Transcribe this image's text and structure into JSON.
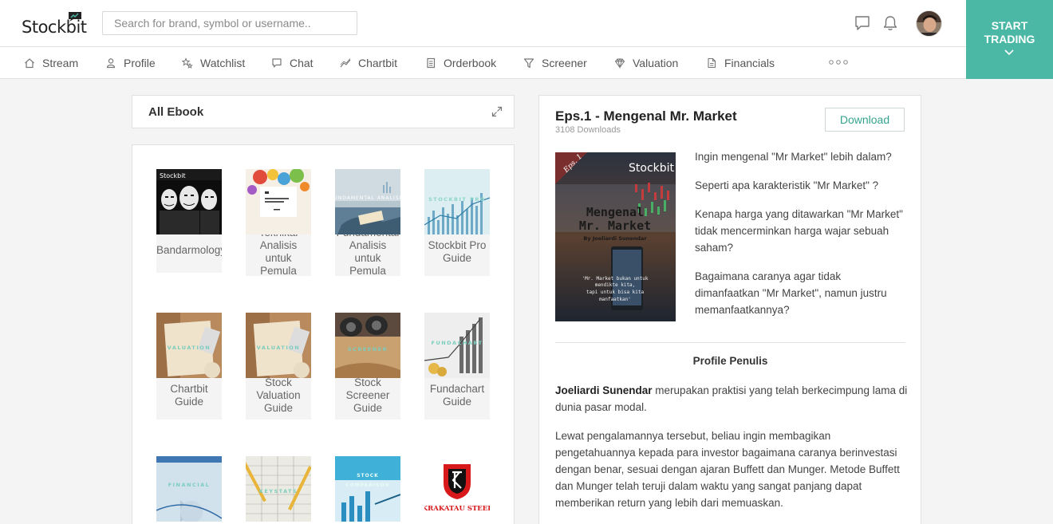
{
  "header": {
    "logo_text": "Stockbit",
    "search_placeholder": "Search for brand, symbol or username..",
    "start_trading_label": "START TRADING"
  },
  "nav": {
    "items": [
      {
        "label": "Stream",
        "icon": "home-icon"
      },
      {
        "label": "Profile",
        "icon": "user-icon"
      },
      {
        "label": "Watchlist",
        "icon": "stars-icon"
      },
      {
        "label": "Chat",
        "icon": "chat-icon"
      },
      {
        "label": "Chartbit",
        "icon": "chart-line-icon"
      },
      {
        "label": "Orderbook",
        "icon": "document-icon"
      },
      {
        "label": "Screener",
        "icon": "filter-icon"
      },
      {
        "label": "Valuation",
        "icon": "diamond-icon"
      },
      {
        "label": "Financials",
        "icon": "file-icon"
      }
    ]
  },
  "ebook_list": {
    "title": "All Ebook",
    "books": [
      {
        "title": "Bandarmology"
      },
      {
        "title": "Teknikal Analisis untuk Pemula"
      },
      {
        "title": "Fundamental Analisis untuk Pemula"
      },
      {
        "title": "Stockbit Pro Guide"
      },
      {
        "title": "Chartbit Guide"
      },
      {
        "title": "Stock Valuation Guide"
      },
      {
        "title": "Stock Screener Guide"
      },
      {
        "title": "Fundachart Guide"
      }
    ]
  },
  "detail": {
    "title": "Eps.1 - Mengenal Mr. Market",
    "downloads": "3108 Downloads",
    "download_label": "Download",
    "cover": {
      "badge": "Eps. 1",
      "brand": "Stockbit",
      "title_line1": "Mengenal",
      "title_line2": "Mr. Market",
      "author": "By Joeliardi Sunendar",
      "quote_line1": "'Mr. Market bukan untuk",
      "quote_line2": "mendikte kita,",
      "quote_line3": "tapi untuk bisa kita",
      "quote_line4": "manfaatkan'"
    },
    "questions": [
      "Ingin mengenal \"Mr Market\" lebih dalam?",
      "Seperti apa karakteristik \"Mr Market\" ?",
      "Kenapa harga yang ditawarkan \"Mr Market\" tidak mencerminkan harga wajar sebuah saham?",
      "Bagaimana caranya agar tidak dimanfaatkan \"Mr Market\", namun justru memanfaatkannya?"
    ],
    "profile_heading": "Profile Penulis",
    "author_name": "Joeliardi Sunendar",
    "bio_1_rest": " merupakan praktisi yang telah berkecimpung lama di dunia pasar modal.",
    "bio_2": "Lewat pengalamannya tersebut, beliau ingin membagikan pengetahuannya kepada para investor bagaimana caranya berinvestasi dengan benar, sesuai dengan ajaran Buffett dan Munger. Metode Buffett dan Munger telah teruji dalam waktu yang sangat panjang dapat memberikan return yang lebih dari memuaskan."
  },
  "colors": {
    "accent": "#4bb8a5",
    "download_text": "#35a38f"
  }
}
